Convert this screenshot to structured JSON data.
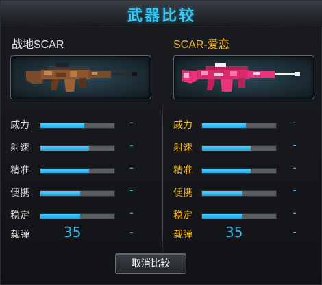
{
  "title": "武器比较",
  "left": {
    "name": "战地SCAR",
    "stats": [
      {
        "label": "威力",
        "fill": 0.59,
        "value": "-"
      },
      {
        "label": "射速",
        "fill": 0.66,
        "value": "-"
      },
      {
        "label": "精准",
        "fill": 0.66,
        "value": "-"
      },
      {
        "label": "便携",
        "fill": 0.54,
        "value": "-"
      },
      {
        "label": "稳定",
        "fill": 0.54,
        "value": "-"
      }
    ],
    "ammo": {
      "label": "载弹",
      "value": "35",
      "extra": "-"
    }
  },
  "right": {
    "name": "SCAR-爱恋",
    "stats": [
      {
        "label": "威力",
        "fill": 0.59,
        "value": "-"
      },
      {
        "label": "射速",
        "fill": 0.66,
        "value": "-"
      },
      {
        "label": "精准",
        "fill": 0.66,
        "value": "-"
      },
      {
        "label": "便携",
        "fill": 0.54,
        "value": "-"
      },
      {
        "label": "稳定",
        "fill": 0.54,
        "value": "-"
      }
    ],
    "ammo": {
      "label": "载弹",
      "value": "35",
      "extra": "-"
    }
  },
  "cancel_label": "取消比较",
  "colors": {
    "accent": "#36c6f4",
    "bar_fill": "#2bb7ee",
    "right_label": "#f2b31c",
    "left_weapon": "#a0522d",
    "right_weapon": "#e8347a"
  },
  "icons": {
    "left_weapon": "scar-rifle-camo",
    "right_weapon": "scar-rifle-pink"
  }
}
